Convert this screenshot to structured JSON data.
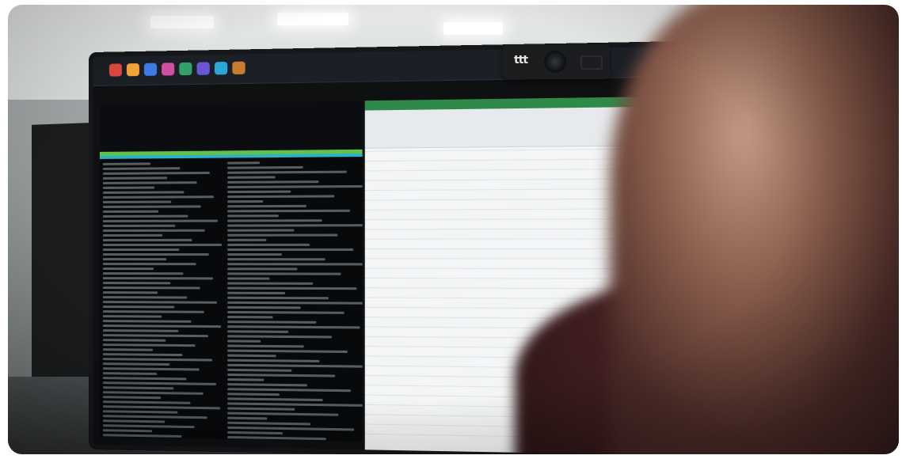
{
  "scene": {
    "webcam_logo_text": "ttt",
    "colors": {
      "terminal_green": "#62c149",
      "terminal_cyan": "#2db1c9",
      "spreadsheet_accent": "#2f8a4a",
      "code_bg": "#0a1e3a",
      "sweater": "#3a1b1d"
    }
  }
}
